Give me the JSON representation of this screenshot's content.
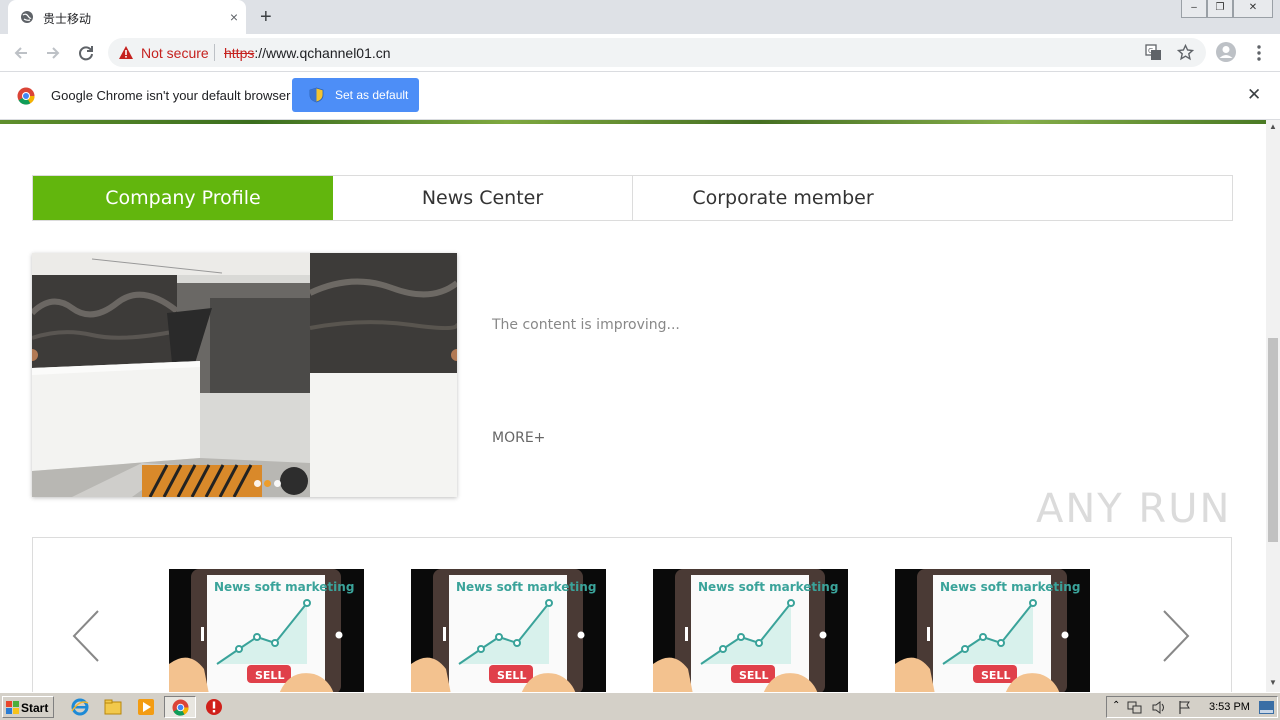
{
  "browser": {
    "tab_title": "贵士移动",
    "tab_close": "×",
    "new_tab": "+",
    "window_controls": [
      "–",
      "❐",
      "✕"
    ],
    "security_label": "Not secure",
    "url_protocol": "https",
    "url_rest": "://www.qchannel01.cn"
  },
  "infobar": {
    "message": "Google Chrome isn't your default browser",
    "button_label": "Set as default",
    "close": "✕"
  },
  "page": {
    "tabs": [
      "Company Profile",
      "News Center",
      "Corporate member"
    ],
    "content_text": "The content is improving...",
    "more_link": "MORE+",
    "news_cards": [
      {
        "title": "News soft marketing",
        "tag": "SELL"
      },
      {
        "title": "News soft marketing",
        "tag": "SELL"
      },
      {
        "title": "News soft marketing",
        "tag": "SELL"
      },
      {
        "title": "News soft marketing",
        "tag": "SELL"
      }
    ],
    "watermark": "ANY RUN"
  },
  "taskbar": {
    "start_label": "Start",
    "clock": "3:53 PM"
  },
  "colors": {
    "accent_green": "#62b60d",
    "chrome_button_blue": "#4d8ef7",
    "not_secure_red": "#c5221f"
  }
}
